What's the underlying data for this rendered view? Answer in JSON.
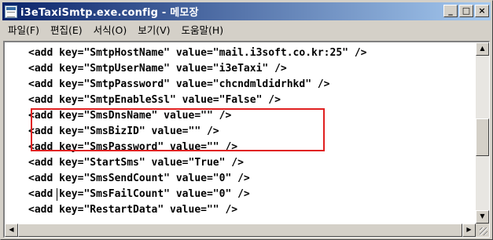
{
  "window": {
    "title": "i3eTaxiSmtp.exe.config - 메모장",
    "minimize_glyph": "_",
    "maximize_glyph": "□",
    "close_glyph": "×"
  },
  "menu": [
    {
      "label": "파일(F)"
    },
    {
      "label": "편집(E)"
    },
    {
      "label": "서식(O)"
    },
    {
      "label": "보기(V)"
    },
    {
      "label": "도움말(H)"
    }
  ],
  "lines": [
    "<add key=\"SmtpHostName\" value=\"mail.i3soft.co.kr:25\" />",
    "<add key=\"SmtpUserName\" value=\"i3eTaxi\" />",
    "<add key=\"SmtpPassword\" value=\"chcndmldidrhkd\" />",
    "<add key=\"SmtpEnableSsl\" value=\"False\" />",
    "<add key=\"SmsDnsName\" value=\"\" />",
    "<add key=\"SmsBizID\" value=\"\" />",
    "<add key=\"SmsPassword\" value=\"\" />",
    "<add key=\"StartSms\" value=\"True\" />",
    "<add key=\"SmsSendCount\" value=\"0\" />",
    "<add key=\"SmsFailCount\" value=\"0\" />",
    "<add key=\"RestartData\" value=\"\" />"
  ],
  "scroll": {
    "up_glyph": "▲",
    "down_glyph": "▼",
    "left_glyph": "◀",
    "right_glyph": "▶"
  },
  "colors": {
    "title_gradient_start": "#0a246a",
    "title_gradient_end": "#a6caf0",
    "highlight_border": "#e02020",
    "chrome": "#d4d0c8"
  },
  "icons": {
    "app": "notepad-icon"
  }
}
